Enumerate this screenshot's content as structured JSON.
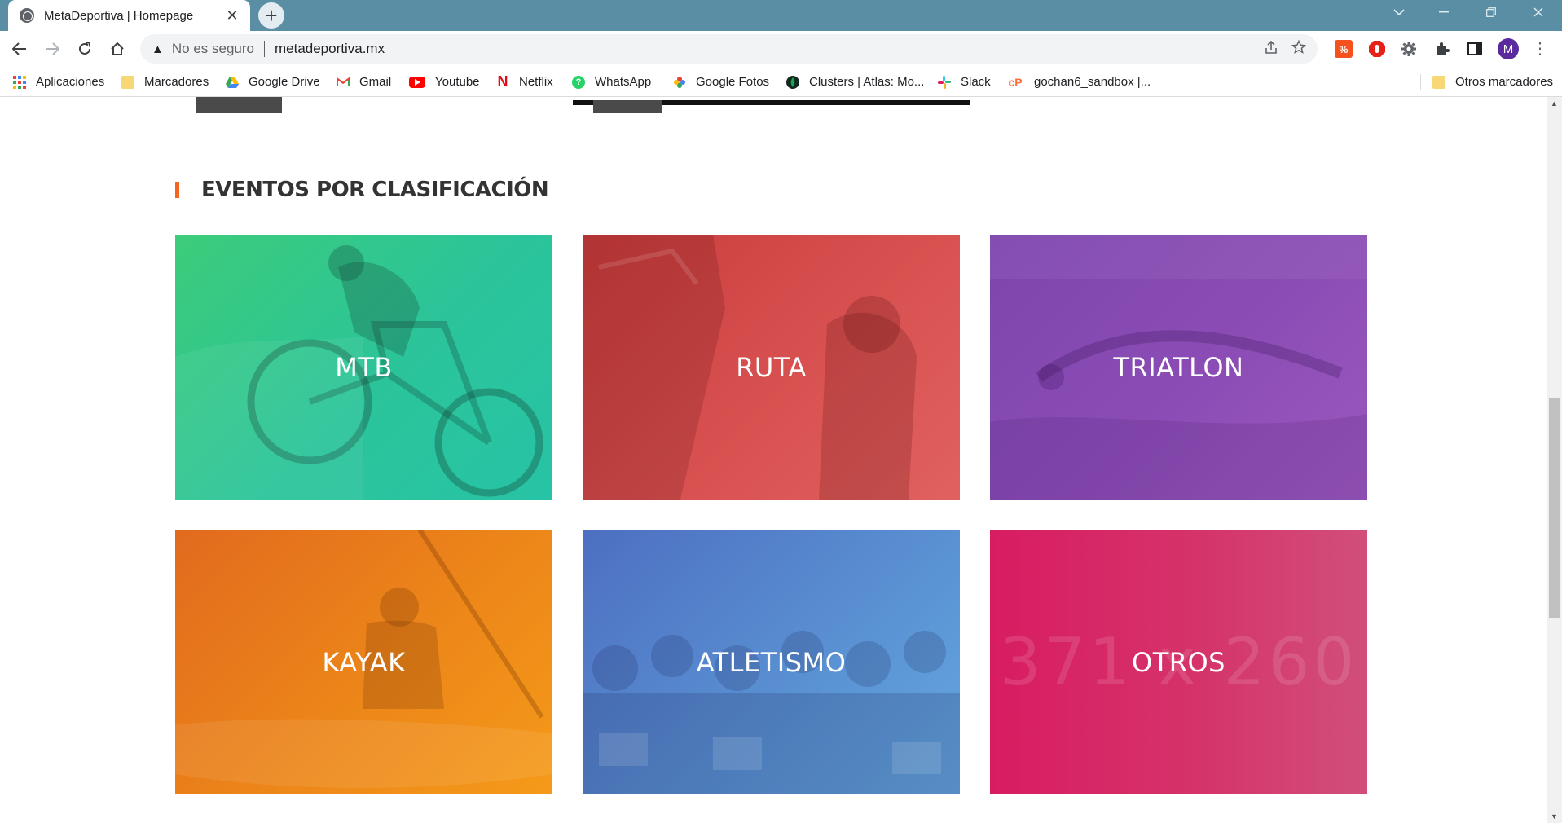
{
  "browser": {
    "tab_title": "MetaDeportiva | Homepage",
    "new_tab_symbol": "+",
    "close_symbol": "✕",
    "not_secure_label": "No es seguro",
    "url": "metadeportiva.mx",
    "profile_initial": "M"
  },
  "bookmarks": [
    {
      "label": "Aplicaciones",
      "icon": "apps-grid-icon"
    },
    {
      "label": "Marcadores",
      "icon": "folder-icon"
    },
    {
      "label": "Google Drive",
      "icon": "google-drive-icon"
    },
    {
      "label": "Gmail",
      "icon": "gmail-icon"
    },
    {
      "label": "Youtube",
      "icon": "youtube-icon"
    },
    {
      "label": "Netflix",
      "icon": "netflix-icon"
    },
    {
      "label": "WhatsApp",
      "icon": "whatsapp-icon"
    },
    {
      "label": "Google Fotos",
      "icon": "google-photos-icon"
    },
    {
      "label": "Clusters | Atlas: Mo...",
      "icon": "mongodb-atlas-icon"
    },
    {
      "label": "Slack",
      "icon": "slack-icon"
    },
    {
      "label": "gochan6_sandbox |...",
      "icon": "postman-icon"
    },
    {
      "label": "Otros marcadores",
      "icon": "folder-icon"
    }
  ],
  "section": {
    "title": "EVENTOS POR CLASIFICACIÓN",
    "accent_color": "#f26522"
  },
  "categories": [
    {
      "label": "MTB",
      "color": "#2fc58f"
    },
    {
      "label": "RUTA",
      "color": "#d24b4a"
    },
    {
      "label": "TRIATLON",
      "color": "#8a4db4"
    },
    {
      "label": "KAYAK",
      "color": "#ec8619"
    },
    {
      "label": "ATLETISMO",
      "color": "#5a8fd1"
    },
    {
      "label": "OTROS",
      "color": "#d5306a",
      "placeholder_text": "371 x 260"
    }
  ]
}
